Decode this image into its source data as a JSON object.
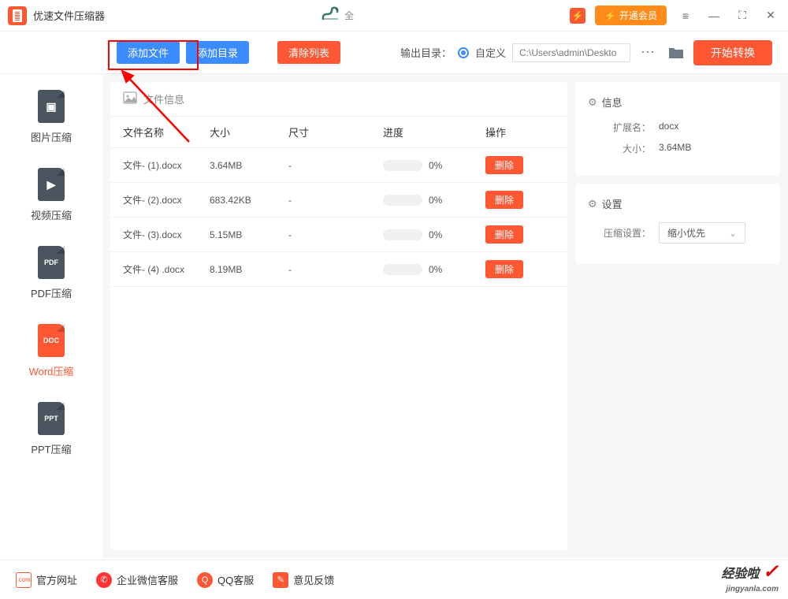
{
  "app": {
    "title": "优速文件压缩器",
    "center_text": "全",
    "vip_button": "开通会员"
  },
  "toolbar": {
    "add_file": "添加文件",
    "add_folder": "添加目录",
    "clear_list": "清除列表",
    "output_label": "输出目录：",
    "output_mode": "自定义",
    "output_path": "C:\\Users\\admin\\Deskto",
    "start_convert": "开始转换"
  },
  "sidebar": [
    {
      "label": "图片压缩",
      "badge": "▣"
    },
    {
      "label": "视频压缩",
      "badge": "▶"
    },
    {
      "label": "PDF压缩",
      "badge": "PDF"
    },
    {
      "label": "Word压缩",
      "badge": "DOC"
    },
    {
      "label": "PPT压缩",
      "badge": "PPT"
    }
  ],
  "file_panel": {
    "header": "文件信息",
    "columns": {
      "name": "文件名称",
      "size": "大小",
      "dim": "尺寸",
      "progress": "进度",
      "action": "操作"
    },
    "delete_label": "删除",
    "rows": [
      {
        "name": "文件- (1).docx",
        "size": "3.64MB",
        "dim": "-",
        "progress": "0%"
      },
      {
        "name": "文件- (2).docx",
        "size": "683.42KB",
        "dim": "-",
        "progress": "0%"
      },
      {
        "name": "文件- (3).docx",
        "size": "5.15MB",
        "dim": "-",
        "progress": "0%"
      },
      {
        "name": "文件- (4) .docx",
        "size": "8.19MB",
        "dim": "-",
        "progress": "0%"
      }
    ]
  },
  "info_panel": {
    "title": "信息",
    "ext_label": "扩展名：",
    "ext_value": "docx",
    "size_label": "大小：",
    "size_value": "3.64MB"
  },
  "settings_panel": {
    "title": "设置",
    "compress_label": "压缩设置：",
    "compress_value": "缩小优先"
  },
  "footer": {
    "website": "官方网址",
    "wechat": "企业微信客服",
    "qq": "QQ客服",
    "feedback": "意见反馈"
  },
  "watermark": {
    "brand": "经验啦",
    "url": "jingyanla.com"
  }
}
